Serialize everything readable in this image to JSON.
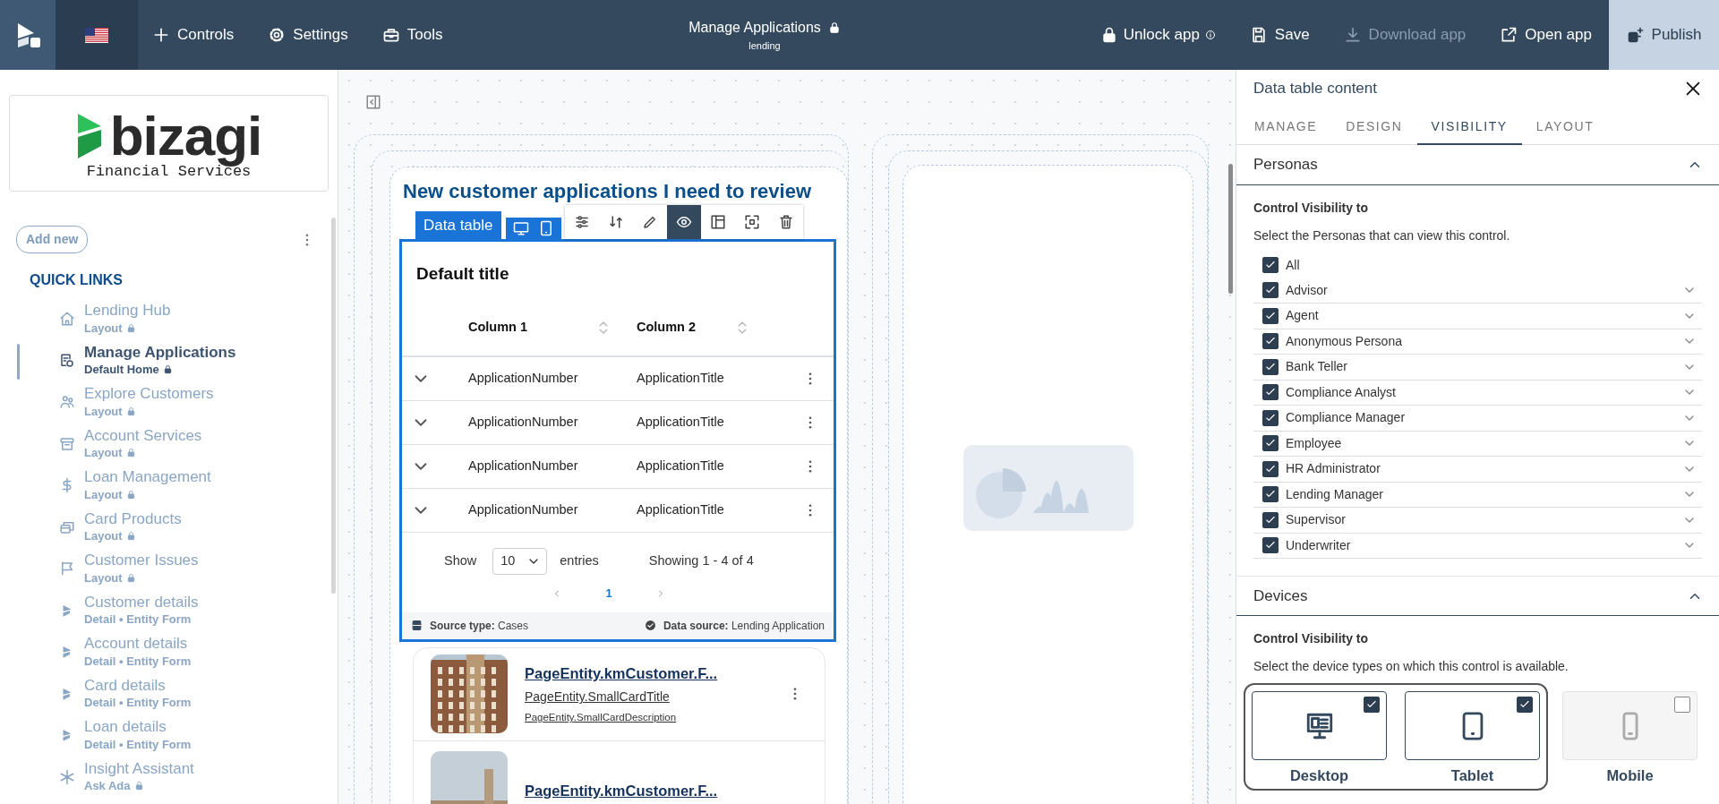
{
  "topbar": {
    "menus": [
      {
        "label": "Controls"
      },
      {
        "label": "Settings"
      },
      {
        "label": "Tools"
      }
    ],
    "app": {
      "title": "Manage Applications",
      "locked": true,
      "subtitle": "lending"
    },
    "actions": [
      {
        "label": "Unlock app",
        "info": true,
        "disabled": false
      },
      {
        "label": "Save",
        "info": false,
        "disabled": false
      },
      {
        "label": "Download app",
        "info": false,
        "disabled": true
      },
      {
        "label": "Open app",
        "info": false,
        "disabled": false
      }
    ],
    "publish": {
      "label": "Publish"
    }
  },
  "sidebar": {
    "logo": {
      "name": "bizagi",
      "tagline": "Financial Services"
    },
    "add_new": "Add new",
    "section": "QUICK LINKS",
    "items": [
      {
        "title": "Lending Hub",
        "subtitle": "Layout",
        "locked": true,
        "selected": false
      },
      {
        "title": "Manage Applications",
        "subtitle": "Default Home",
        "locked": true,
        "selected": true
      },
      {
        "title": "Explore Customers",
        "subtitle": "Layout",
        "locked": true,
        "selected": false
      },
      {
        "title": "Account Services",
        "subtitle": "Layout",
        "locked": true,
        "selected": false
      },
      {
        "title": "Loan Management",
        "subtitle": "Layout",
        "locked": true,
        "selected": false
      },
      {
        "title": "Card Products",
        "subtitle": "Layout",
        "locked": true,
        "selected": false
      },
      {
        "title": "Customer Issues",
        "subtitle": "Layout",
        "locked": true,
        "selected": false
      },
      {
        "title": "Customer details",
        "subtitle": "Detail • Entity Form",
        "locked": false,
        "selected": false
      },
      {
        "title": "Account details",
        "subtitle": "Detail • Entity Form",
        "locked": false,
        "selected": false
      },
      {
        "title": "Card details",
        "subtitle": "Detail • Entity Form",
        "locked": false,
        "selected": false
      },
      {
        "title": "Loan details",
        "subtitle": "Detail • Entity Form",
        "locked": false,
        "selected": false
      },
      {
        "title": "Insight Assistant",
        "subtitle": "Ask Ada",
        "locked": true,
        "selected": false
      }
    ]
  },
  "canvas": {
    "heading": "New customer applications I need to review",
    "data_table": {
      "label": "Data table",
      "devices_selected": true,
      "tools": [
        {
          "selected": false
        },
        {
          "selected": false
        },
        {
          "selected": false
        },
        {
          "selected": true
        },
        {
          "selected": false
        },
        {
          "selected": false
        },
        {
          "selected": false
        }
      ],
      "title": "Default title",
      "columns": [
        "Column 1",
        "Column 2"
      ],
      "rows": [
        [
          "ApplicationNumber",
          "ApplicationTitle"
        ],
        [
          "ApplicationNumber",
          "ApplicationTitle"
        ],
        [
          "ApplicationNumber",
          "ApplicationTitle"
        ],
        [
          "ApplicationNumber",
          "ApplicationTitle"
        ]
      ],
      "show": "Show",
      "page_size": "10",
      "entries": "entries",
      "summary": "Showing 1 - 4 of 4",
      "page": "1",
      "source_type_label": "Source type:",
      "source_type": "Cases",
      "data_source_label": "Data source:",
      "data_source": "Lending Application"
    },
    "cards": [
      {
        "title": "PageEntity.kmCustomer.F...",
        "subtitle": "PageEntity.SmallCardTitle",
        "description": "PageEntity.SmallCardDescription"
      },
      {
        "title": "PageEntity.kmCustomer.F..."
      }
    ]
  },
  "panel": {
    "title": "Data table content",
    "tabs": [
      {
        "label": "MANAGE",
        "selected": false
      },
      {
        "label": "DESIGN",
        "selected": false
      },
      {
        "label": "VISIBILITY",
        "selected": true
      },
      {
        "label": "LAYOUT",
        "selected": false
      }
    ],
    "personas": {
      "title": "Personas",
      "expanded": true,
      "heading": "Control Visibility to",
      "hint": "Select the Personas that can view this control.",
      "items": [
        {
          "kind": "all",
          "label": "All",
          "checked": true
        },
        {
          "kind": "persona",
          "label": "Advisor",
          "checked": true
        },
        {
          "kind": "persona",
          "label": "Agent",
          "checked": true
        },
        {
          "kind": "persona",
          "label": "Anonymous Persona",
          "checked": true
        },
        {
          "kind": "persona",
          "label": "Bank Teller",
          "checked": true
        },
        {
          "kind": "persona",
          "label": "Compliance Analyst",
          "checked": true
        },
        {
          "kind": "persona",
          "label": "Compliance Manager",
          "checked": true
        },
        {
          "kind": "persona",
          "label": "Employee",
          "checked": true
        },
        {
          "kind": "persona",
          "label": "HR Administrator",
          "checked": true
        },
        {
          "kind": "persona",
          "label": "Lending Manager",
          "checked": true
        },
        {
          "kind": "persona",
          "label": "Supervisor",
          "checked": true
        },
        {
          "kind": "persona",
          "label": "Underwriter",
          "checked": true
        }
      ]
    },
    "devices": {
      "title": "Devices",
      "expanded": true,
      "heading": "Control Visibility to",
      "hint": "Select the device types on which this control is available.",
      "items": [
        {
          "label": "Desktop",
          "checked": true
        },
        {
          "label": "Tablet",
          "checked": true
        },
        {
          "label": "Mobile",
          "checked": false
        }
      ]
    }
  }
}
